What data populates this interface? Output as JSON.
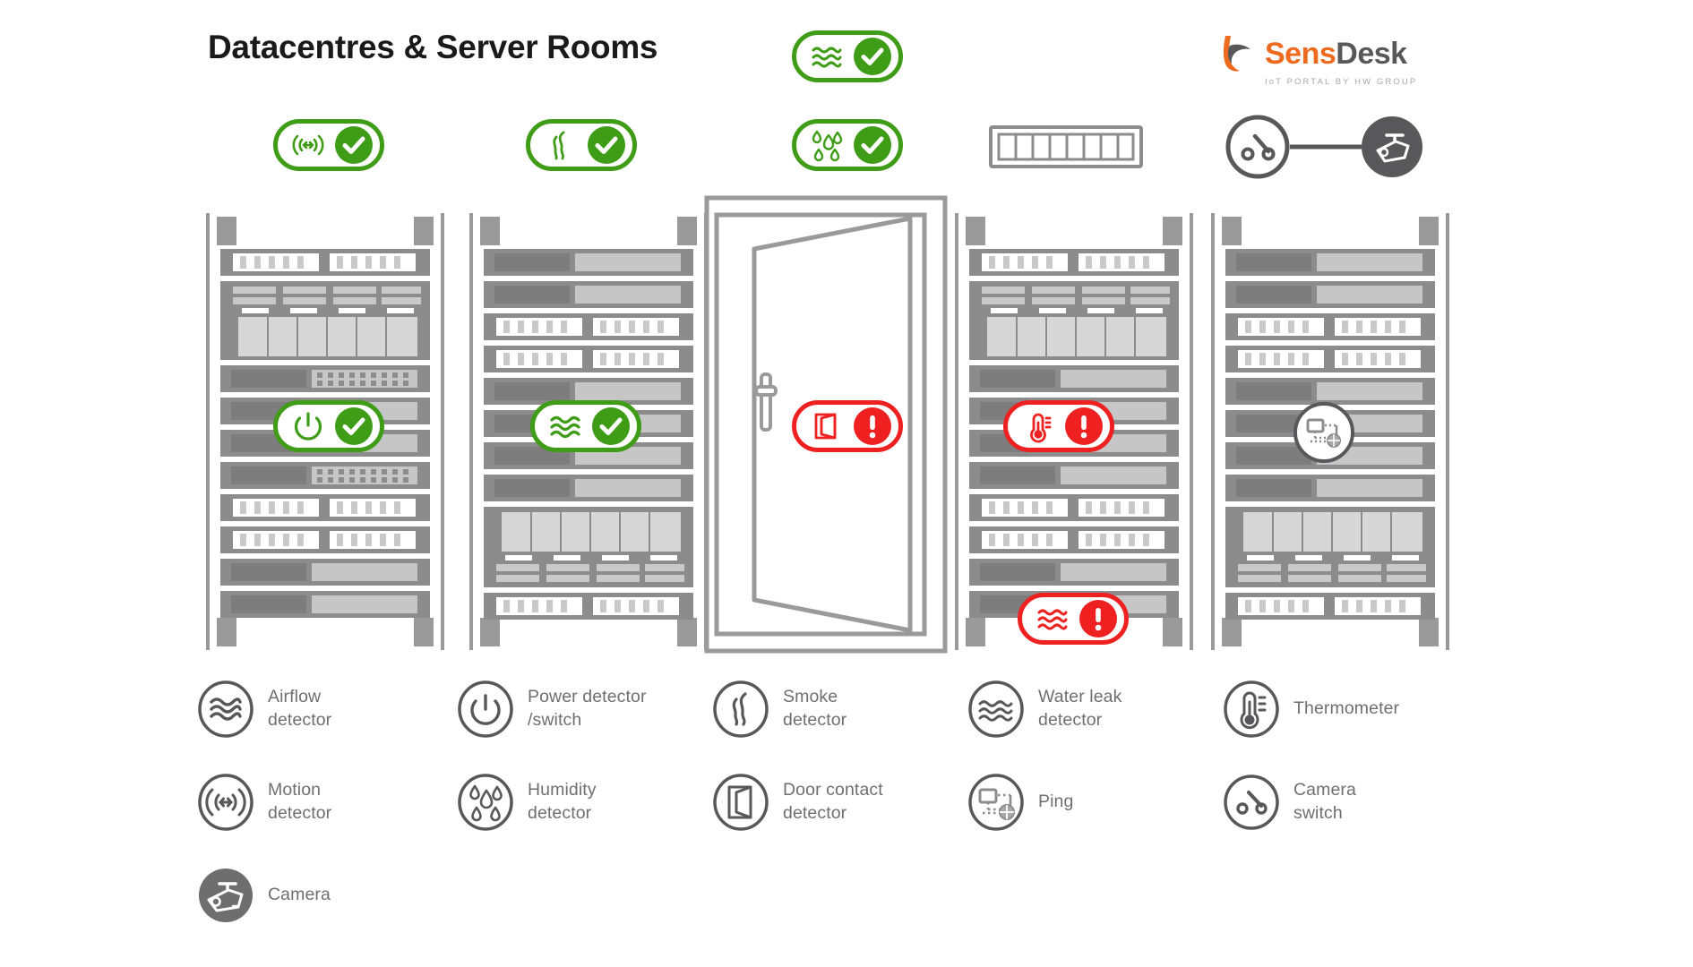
{
  "header": {
    "title": "Datacentres & Server Rooms",
    "brand": {
      "part1": "Sens",
      "part2": "Desk",
      "tagline": "IoT PORTAL BY HW GROUP"
    }
  },
  "colors": {
    "ok_green": "#3e9c16",
    "alert_red": "#ee2020",
    "rack_gray": "#8c8c8c",
    "text_gray": "#6f6f6f",
    "brand_orange": "#ee6a1e",
    "brand_gray": "#58585a"
  },
  "status_badges": [
    {
      "id": "motion",
      "icon": "motion-detector-icon",
      "state": "ok",
      "state_label": "OK"
    },
    {
      "id": "smoke",
      "icon": "smoke-detector-icon",
      "state": "ok",
      "state_label": "OK"
    },
    {
      "id": "humidity",
      "icon": "humidity-detector-icon",
      "state": "ok",
      "state_label": "OK"
    },
    {
      "id": "waterleak_top",
      "icon": "water-leak-detector-icon",
      "state": "ok",
      "state_label": "OK"
    },
    {
      "id": "power",
      "icon": "power-detector-icon",
      "state": "ok",
      "state_label": "OK"
    },
    {
      "id": "airflow",
      "icon": "airflow-detector-icon",
      "state": "ok",
      "state_label": "OK"
    },
    {
      "id": "door",
      "icon": "door-contact-detector-icon",
      "state": "alert",
      "state_label": "ALERT"
    },
    {
      "id": "thermometer",
      "icon": "thermometer-icon",
      "state": "alert",
      "state_label": "ALERT"
    },
    {
      "id": "waterleak_rack",
      "icon": "water-leak-detector-icon",
      "state": "alert",
      "state_label": "ALERT"
    }
  ],
  "devices": [
    {
      "id": "patch-panel",
      "icon": "patch-panel-icon",
      "ports": 8
    },
    {
      "id": "camera-switch",
      "icon": "camera-switch-icon"
    },
    {
      "id": "camera",
      "icon": "camera-icon"
    },
    {
      "id": "ping",
      "icon": "ping-icon"
    }
  ],
  "racks": [
    {
      "id": "rack-1",
      "badge": "power"
    },
    {
      "id": "rack-2",
      "badge": "airflow"
    },
    {
      "id": "rack-3",
      "badge": "thermometer"
    },
    {
      "id": "rack-4",
      "badge": "ping"
    }
  ],
  "door": {
    "id": "server-room-door",
    "state": "open",
    "badge": "door"
  },
  "legend": {
    "row1": [
      {
        "icon": "airflow-detector-icon",
        "label": "Airflow\ndetector"
      },
      {
        "icon": "power-detector-icon",
        "label": "Power detector\n/switch"
      },
      {
        "icon": "smoke-detector-icon",
        "label": "Smoke\ndetector"
      },
      {
        "icon": "water-leak-detector-icon",
        "label": "Water leak\ndetector"
      },
      {
        "icon": "thermometer-icon",
        "label": "Thermometer"
      }
    ],
    "row2": [
      {
        "icon": "motion-detector-icon",
        "label": "Motion\ndetector"
      },
      {
        "icon": "humidity-detector-icon",
        "label": "Humidity\ndetector"
      },
      {
        "icon": "door-contact-detector-icon",
        "label": "Door contact\ndetector"
      },
      {
        "icon": "ping-icon",
        "label": "Ping"
      },
      {
        "icon": "camera-switch-icon",
        "label": "Camera\nswitch"
      }
    ],
    "row3": [
      {
        "icon": "camera-icon",
        "label": "Camera"
      }
    ]
  }
}
